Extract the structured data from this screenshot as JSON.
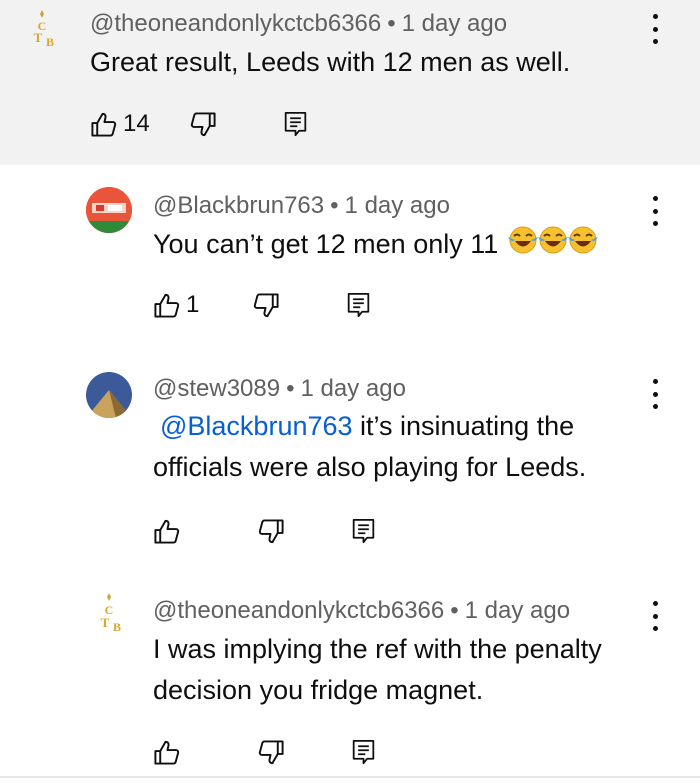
{
  "comments": [
    {
      "handle": "@theoneandonlykctcb6366",
      "age": "1 day ago",
      "text": "Great result, Leeds with 12 men as well.",
      "likes": "14",
      "highlighted": true
    },
    {
      "handle": "@Blackbrun763",
      "age": "1 day ago",
      "text": "You can’t get 12 men only 11",
      "emojis": [
        "face-with-tears-of-joy",
        "face-with-tears-of-joy",
        "face-with-tears-of-joy"
      ],
      "likes": "1"
    },
    {
      "handle": "@stew3089",
      "age": "1 day ago",
      "mention": "@Blackbrun763",
      "text": " it’s insinuating the officials were also playing for Leeds.",
      "likes": ""
    },
    {
      "handle": "@theoneandonlykctcb6366",
      "age": "1 day ago",
      "text": "I was implying the ref with the penalty decision you fridge magnet.",
      "likes": ""
    }
  ],
  "separator": "•",
  "icons": {
    "like": "thumb-up-icon",
    "dislike": "thumb-down-icon",
    "reply": "reply-comment-icon",
    "menu": "more-vertical-icon"
  },
  "colors": {
    "highlight_bg": "#f2f2f2",
    "mention": "#065fd4",
    "meta": "#606060"
  }
}
